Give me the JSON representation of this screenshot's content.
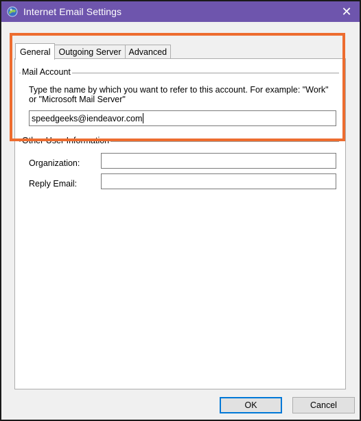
{
  "window": {
    "title": "Internet Email Settings",
    "close_glyph": "✕",
    "titlebar_color": "#6e55ad",
    "highlight_color": "#ed6c2f"
  },
  "tabs": [
    {
      "label": "General",
      "active": true
    },
    {
      "label": "Outgoing Server",
      "active": false
    },
    {
      "label": "Advanced",
      "active": false
    }
  ],
  "mail_account": {
    "group_label": "Mail Account",
    "description": "Type the name by which you want to refer to this account. For example: \"Work\" or \"Microsoft Mail Server\"",
    "account_name_value": "speedgeeks@iendeavor.com"
  },
  "other_info": {
    "group_label": "Other User Information",
    "organization_label": "Organization:",
    "organization_value": "",
    "reply_email_label": "Reply Email:",
    "reply_email_value": ""
  },
  "buttons": {
    "ok_label": "OK",
    "cancel_label": "Cancel"
  }
}
